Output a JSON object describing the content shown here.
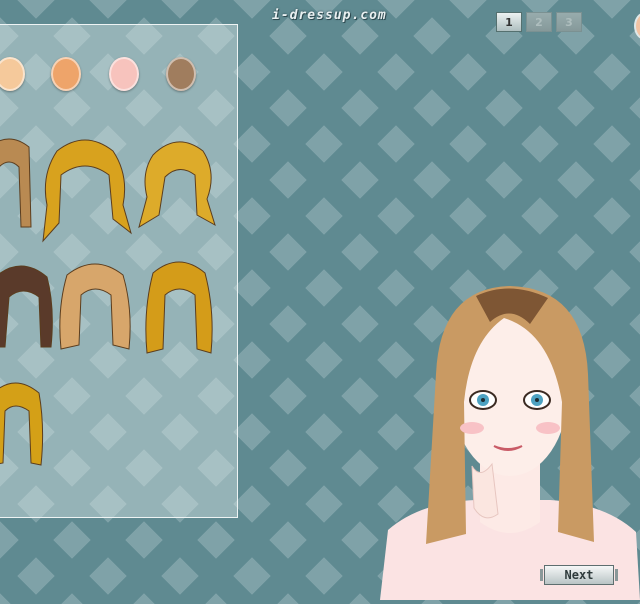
{
  "header": {
    "site_title": "i-dressup.com"
  },
  "page_nav": {
    "pages": [
      "1",
      "2",
      "3"
    ],
    "current": "1"
  },
  "skin_tones": [
    {
      "id": "skin-1",
      "color": "#f5c99b"
    },
    {
      "id": "skin-2",
      "color": "#eea46a"
    },
    {
      "id": "skin-3",
      "color": "#f7c3bd"
    },
    {
      "id": "skin-4",
      "color": "#a07d5e"
    }
  ],
  "hairstyles": [
    {
      "id": "hair-1",
      "color": "#b98a52"
    },
    {
      "id": "hair-2",
      "color": "#d8a21e"
    },
    {
      "id": "hair-3",
      "color": "#ddab2a"
    },
    {
      "id": "hair-4",
      "color": "#5a3a2a"
    },
    {
      "id": "hair-5",
      "color": "#d7a66b"
    },
    {
      "id": "hair-6",
      "color": "#d49c19"
    },
    {
      "id": "hair-7",
      "color": "#d4a017"
    }
  ],
  "footer": {
    "next_label": "Next"
  }
}
